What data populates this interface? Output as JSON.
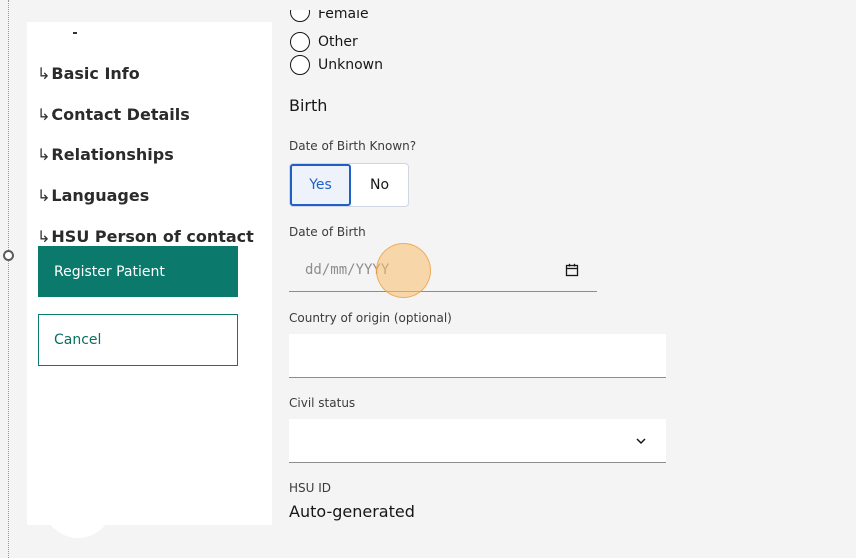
{
  "sidebar": {
    "items": [
      {
        "label": "Basic Info"
      },
      {
        "label": "Contact Details"
      },
      {
        "label": "Relationships"
      },
      {
        "label": "Languages"
      },
      {
        "label": "HSU Person of contact"
      }
    ],
    "arrow_glyph": "↳",
    "register_label": "Register Patient",
    "cancel_label": "Cancel"
  },
  "form": {
    "sex_options": [
      {
        "label": "Female"
      },
      {
        "label": "Other"
      },
      {
        "label": "Unknown"
      }
    ],
    "birth_section_title": "Birth",
    "dob_known_label": "Date of Birth Known?",
    "dob_known_options": [
      {
        "label": "Yes",
        "selected": true
      },
      {
        "label": "No",
        "selected": false
      }
    ],
    "dob_label": "Date of Birth",
    "dob_placeholder": "dd/mm/YYYY",
    "country_label": "Country of origin (optional)",
    "country_value": "",
    "civil_status_label": "Civil status",
    "civil_status_value": "",
    "hsu_id_label": "HSU ID",
    "hsu_id_value": "Auto-generated"
  },
  "icons": {
    "calendar": "calendar-icon",
    "chevron": "chevron-down-icon"
  },
  "colors": {
    "primary": "#0b7a6c",
    "toggle_selected": "#1f5fc6",
    "click_indicator": "#fabe6e"
  }
}
